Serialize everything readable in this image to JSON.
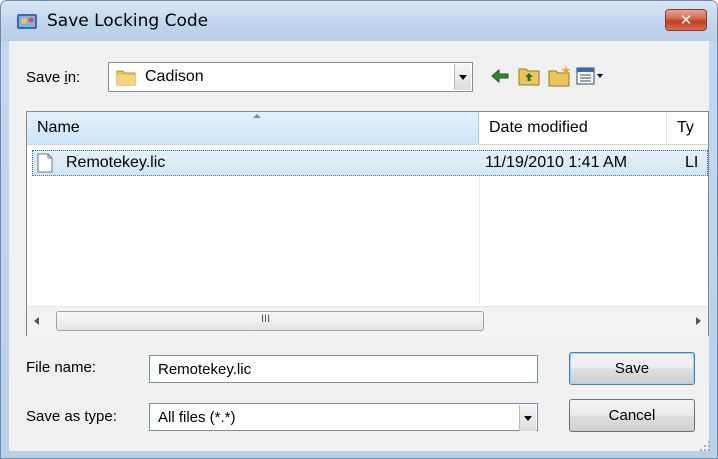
{
  "window": {
    "title": "Save Locking Code",
    "close_label": "✕"
  },
  "toolbar": {
    "save_in_label": "Save in:",
    "save_in_access_key": "i",
    "save_in_value": "Cadison",
    "buttons": [
      {
        "name": "back-icon"
      },
      {
        "name": "up-folder-icon"
      },
      {
        "name": "new-folder-icon"
      },
      {
        "name": "view-menu-icon"
      }
    ]
  },
  "list": {
    "columns": [
      "Name",
      "Date modified",
      "Ty"
    ],
    "rows": [
      {
        "name": "Remotekey.lic",
        "date": "11/19/2010 1:41 AM",
        "type": "LI"
      }
    ],
    "scroll_grip": "III"
  },
  "form": {
    "file_name_label": "File name:",
    "file_name_value": "Remotekey.lic",
    "save_as_type_label": "Save as type:",
    "save_as_type_value": "All files (*.*)"
  },
  "buttons": {
    "save": "Save",
    "cancel": "Cancel"
  },
  "colors": {
    "accent": "#3c7fb1",
    "selection": "#d3e5f7",
    "close": "#c43c1e"
  }
}
